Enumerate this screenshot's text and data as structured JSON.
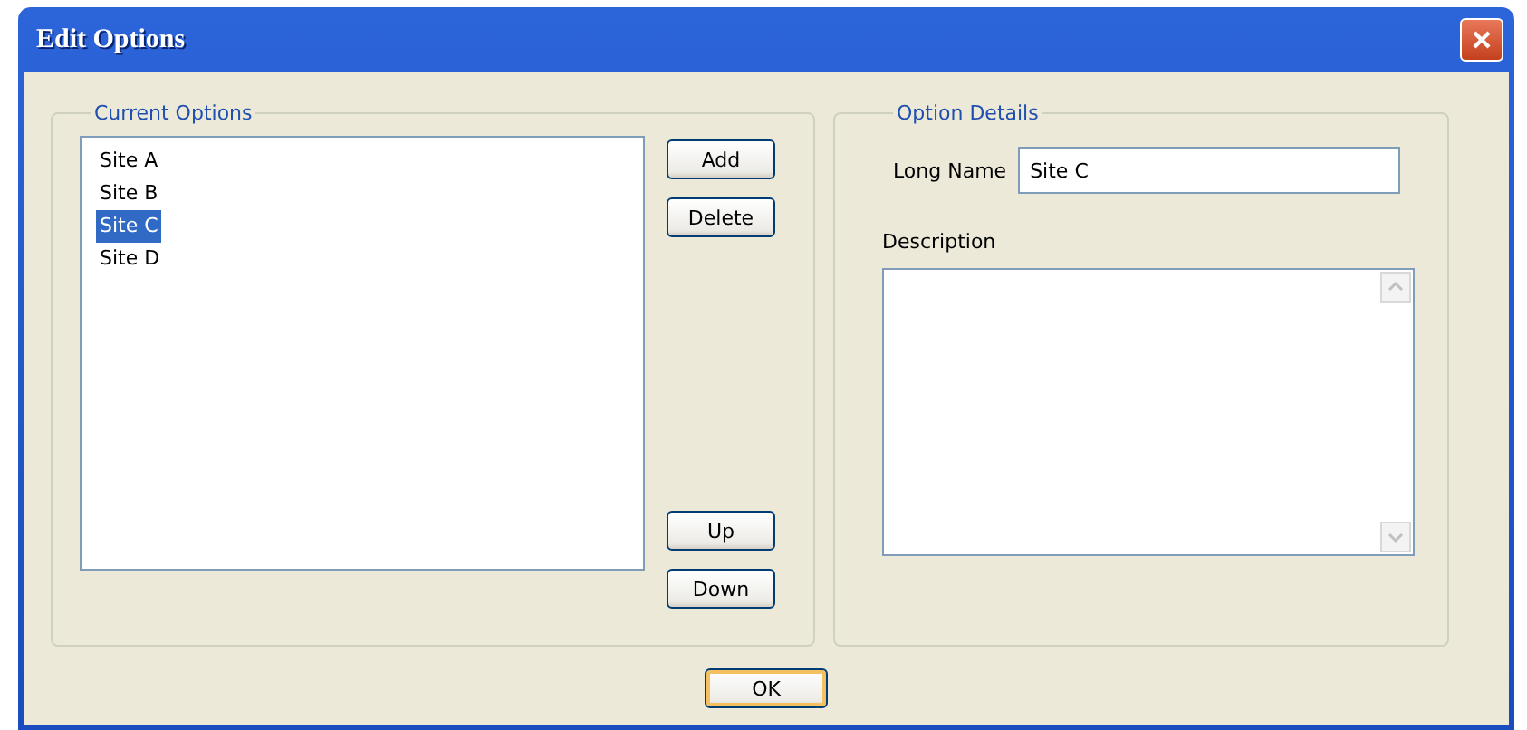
{
  "window": {
    "title": "Edit Options"
  },
  "current_options": {
    "title": "Current Options",
    "items": [
      {
        "label": "Site A",
        "selected": false
      },
      {
        "label": "Site B",
        "selected": false
      },
      {
        "label": "Site C",
        "selected": true
      },
      {
        "label": "Site D",
        "selected": false
      }
    ],
    "buttons_top": [
      "Add",
      "Delete"
    ],
    "buttons_bottom": [
      "Up",
      "Down"
    ]
  },
  "option_details": {
    "title": "Option Details",
    "long_name_label": "Long Name",
    "long_name_value": "Site C",
    "description_label": "Description"
  },
  "buttons": [
    "OK"
  ]
}
